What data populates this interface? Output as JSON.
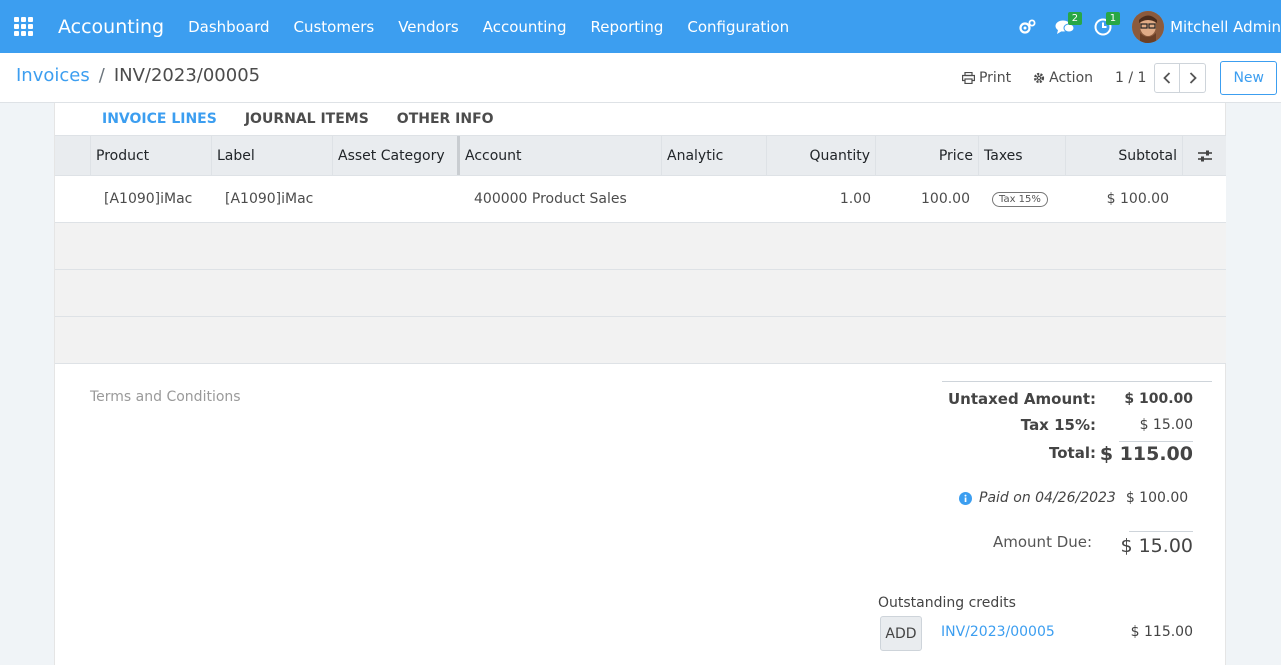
{
  "navbar": {
    "app_name": "Accounting",
    "menu": [
      "Dashboard",
      "Customers",
      "Vendors",
      "Accounting",
      "Reporting",
      "Configuration"
    ],
    "messages_count": "2",
    "activities_count": "1",
    "user_name": "Mitchell Admin"
  },
  "breadcrumb": {
    "parent": "Invoices",
    "separator": "/",
    "current": "INV/2023/00005"
  },
  "control": {
    "print_label": "Print",
    "action_label": "Action",
    "pager": "1 / 1",
    "new_label": "New"
  },
  "tabs": [
    "INVOICE LINES",
    "JOURNAL ITEMS",
    "OTHER INFO"
  ],
  "table": {
    "headers": [
      "Product",
      "Label",
      "Asset Category",
      "Account",
      "Analytic",
      "Quantity",
      "Price",
      "Taxes",
      "Subtotal"
    ],
    "rows": [
      {
        "product": "[A1090]iMac",
        "label": "[A1090]iMac",
        "asset_category": "",
        "account": "400000 Product Sales",
        "analytic": "",
        "quantity": "1.00",
        "price": "100.00",
        "tax": "Tax 15%",
        "subtotal": "$ 100.00"
      }
    ]
  },
  "footer": {
    "terms_placeholder": "Terms and Conditions",
    "untaxed_label": "Untaxed Amount:",
    "untaxed_value": "$ 100.00",
    "tax_label": "Tax 15%:",
    "tax_value": "$ 15.00",
    "total_label": "Total:",
    "total_value": "$ 115.00",
    "paid_text": "Paid on 04/26/2023",
    "paid_value": "$ 100.00",
    "amount_due_label": "Amount Due:",
    "amount_due_value": "$ 15.00",
    "outstanding_label": "Outstanding credits",
    "add_label": "ADD",
    "credit_ref": "INV/2023/00005",
    "credit_amount": "$ 115.00"
  },
  "colors": {
    "brand": "#3c9ef0",
    "badge": "#28a745"
  }
}
